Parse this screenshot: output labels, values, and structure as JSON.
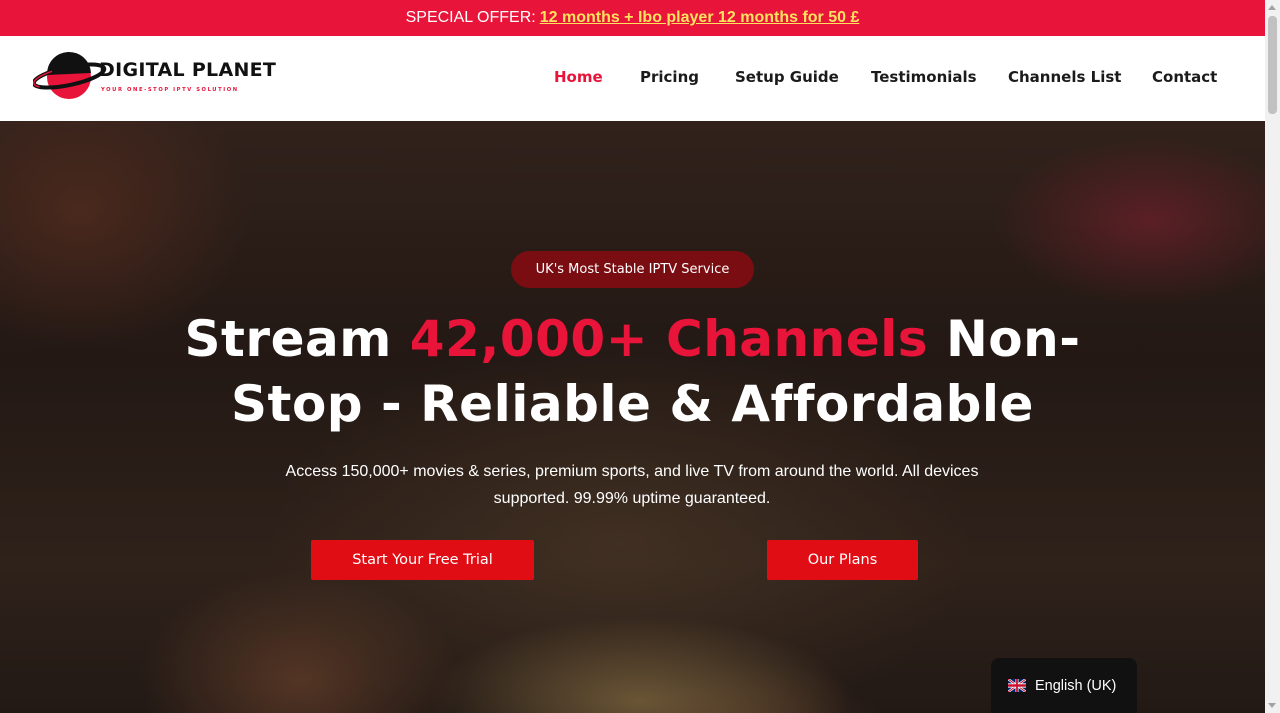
{
  "colors": {
    "brand_red": "#e8143a",
    "offer_link": "#fbe35e",
    "badge_bg": "#7a0d12",
    "cta_bg": "#e00d14"
  },
  "promo": {
    "prefix": "SPECIAL OFFER:",
    "offer_link": "12 months + Ibo player 12 months for 50 £"
  },
  "logo": {
    "name": "DIGITAL PLANET",
    "tagline": "YOUR ONE-STOP IPTV SOLUTION",
    "icon": "planet-logo-icon"
  },
  "nav": {
    "items": [
      {
        "label": "Home",
        "active": true
      },
      {
        "label": "Pricing"
      },
      {
        "label": "Setup Guide"
      },
      {
        "label": "Testimonials"
      },
      {
        "label": "Channels List"
      },
      {
        "label": "Contact"
      }
    ]
  },
  "hero": {
    "badge": "UK's Most Stable IPTV Service",
    "headline_part1": "Stream ",
    "headline_accent": "42,000+ Channels",
    "headline_part2": " Non-Stop - Reliable & Affordable",
    "subtext": "Access 150,000+ movies & series, premium sports, and live TV from around the world. All devices supported. 99.99% uptime guaranteed.",
    "cta_trial": "Start Your Free Trial",
    "cta_plans": "Our Plans"
  },
  "language": {
    "label": "English (UK)",
    "flag_icon": "uk-flag-icon"
  }
}
